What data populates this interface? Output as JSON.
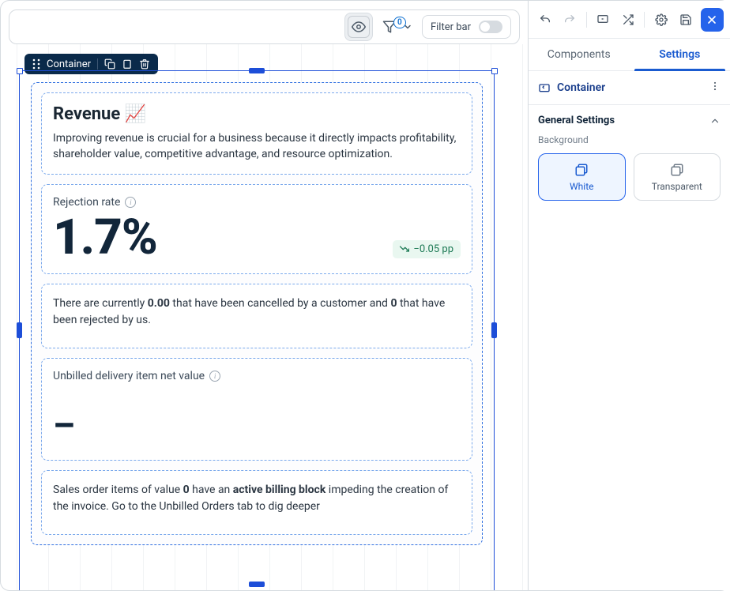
{
  "topbar": {
    "filter_bar_label": "Filter bar",
    "funnel_badge": "0"
  },
  "selection": {
    "label": "Container"
  },
  "content": {
    "header": {
      "title": "Revenue 📈",
      "description": "Improving revenue is crucial for a business because it directly impacts profitability, shareholder value, competitive advantage, and resource optimization."
    },
    "rejection": {
      "label": "Rejection rate",
      "value": "1.7%",
      "delta": "−0.05 pp"
    },
    "cancel_text": {
      "p1": "There are currently ",
      "b1": "0.00",
      "p2": " that have been cancelled by a customer and ",
      "b2": "0",
      "p3": "  that have been rejected by us."
    },
    "unbilled": {
      "label": "Unbilled delivery item net value",
      "value": "–"
    },
    "billing_text": {
      "p1": "Sales order items of value ",
      "b1": "0",
      "p2": " have an ",
      "b2": "active billing block",
      "p3": " impeding the creation of the invoice. Go to the Unbilled Orders tab to dig deeper"
    }
  },
  "right": {
    "tabs": {
      "components": "Components",
      "settings": "Settings"
    },
    "component_name": "Container",
    "section": "General Settings",
    "prop_background": "Background",
    "tile_white": "White",
    "tile_transparent": "Transparent"
  }
}
